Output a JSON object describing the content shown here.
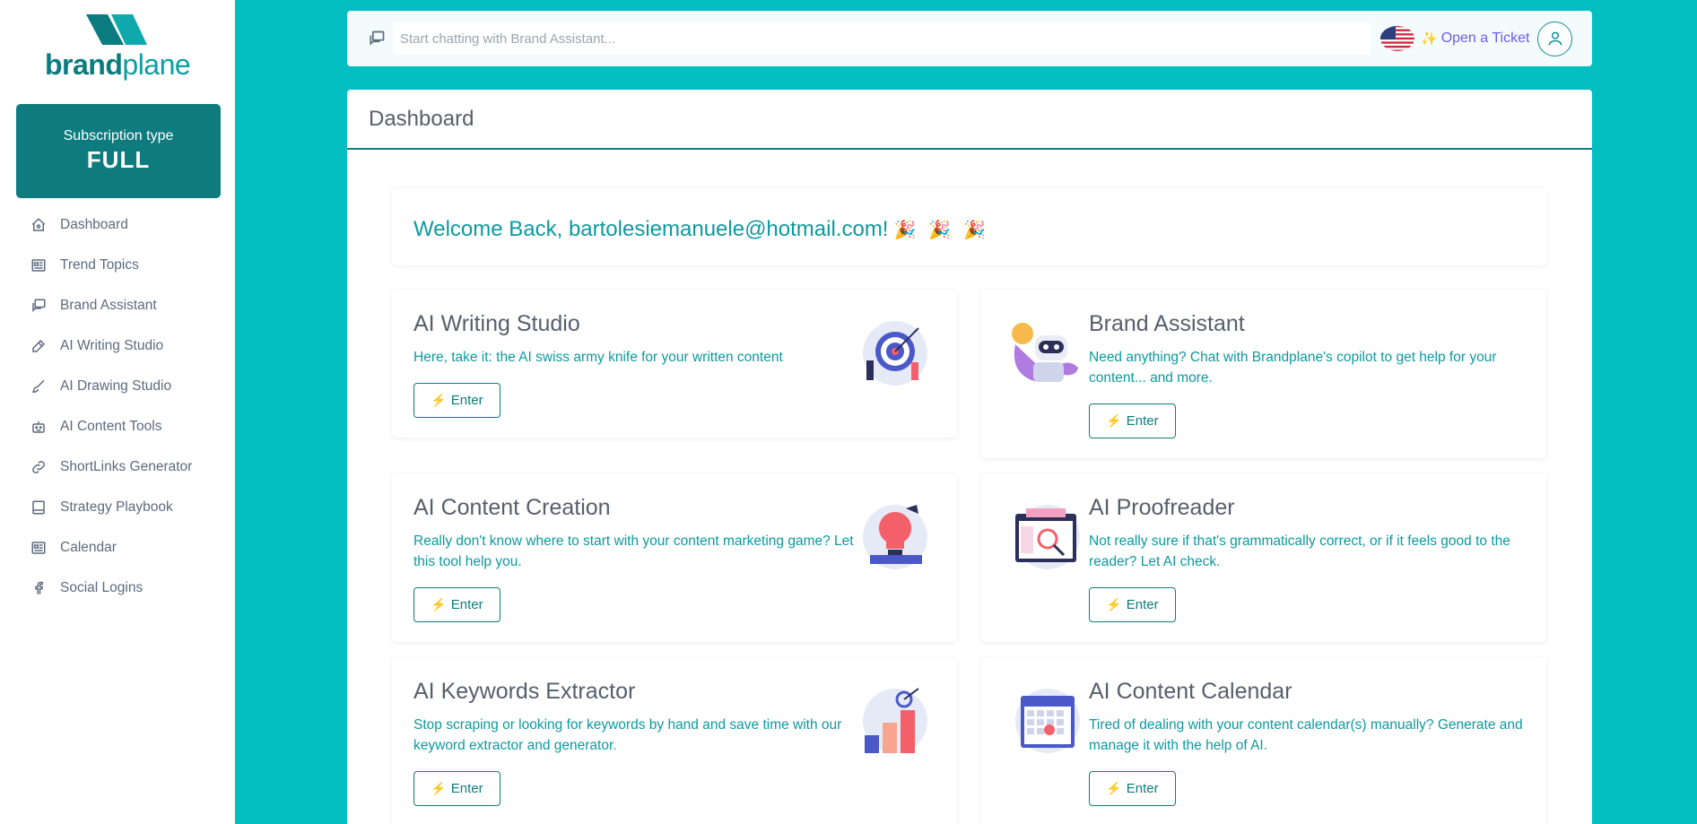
{
  "brand": {
    "part1": "brand",
    "part2": "plane"
  },
  "subscription": {
    "label": "Subscription type",
    "value": "FULL"
  },
  "nav": [
    {
      "label": "Dashboard",
      "icon": "home-icon"
    },
    {
      "label": "Trend Topics",
      "icon": "newspaper-icon"
    },
    {
      "label": "Brand Assistant",
      "icon": "chat-icon"
    },
    {
      "label": "AI Writing Studio",
      "icon": "pen-icon"
    },
    {
      "label": "AI Drawing Studio",
      "icon": "brush-icon"
    },
    {
      "label": "AI Content Tools",
      "icon": "robot-icon"
    },
    {
      "label": "ShortLinks Generator",
      "icon": "link-icon"
    },
    {
      "label": "Strategy Playbook",
      "icon": "book-icon"
    },
    {
      "label": "Calendar",
      "icon": "newspaper-icon"
    },
    {
      "label": "Social Logins",
      "icon": "facebook-icon"
    }
  ],
  "topbar": {
    "placeholder": "Start chatting with Brand Assistant...",
    "ticket_label": "Open a Ticket"
  },
  "main": {
    "title": "Dashboard"
  },
  "welcome": {
    "text": "Welcome Back, bartolesiemanuele@hotmail.com!",
    "emoji": "🎉🎉🎉"
  },
  "enter_label": "Enter",
  "tools": [
    {
      "title": "AI Writing Studio",
      "desc": "Here, take it: the AI swiss army knife for your written content",
      "illustration": "target-illustration"
    },
    {
      "title": "Brand Assistant",
      "desc": "Need anything? Chat with Brandplane's copilot to get help for your content... and more.",
      "illustration": "robot-illustration"
    },
    {
      "title": "AI Content Creation",
      "desc": "Really don't know where to start with your content marketing game? Let this tool help you.",
      "illustration": "lightbulb-illustration"
    },
    {
      "title": "AI Proofreader",
      "desc": "Not really sure if that's grammatically correct, or if it feels good to the reader? Let AI check.",
      "illustration": "approved-illustration"
    },
    {
      "title": "AI Keywords Extractor",
      "desc": "Stop scraping or looking for keywords by hand and save time with our keyword extractor and generator.",
      "illustration": "growth-illustration"
    },
    {
      "title": "AI Content Calendar",
      "desc": "Tired of dealing with your content calendar(s) manually? Generate and manage it with the help of AI.",
      "illustration": "calendar-illustration"
    }
  ]
}
